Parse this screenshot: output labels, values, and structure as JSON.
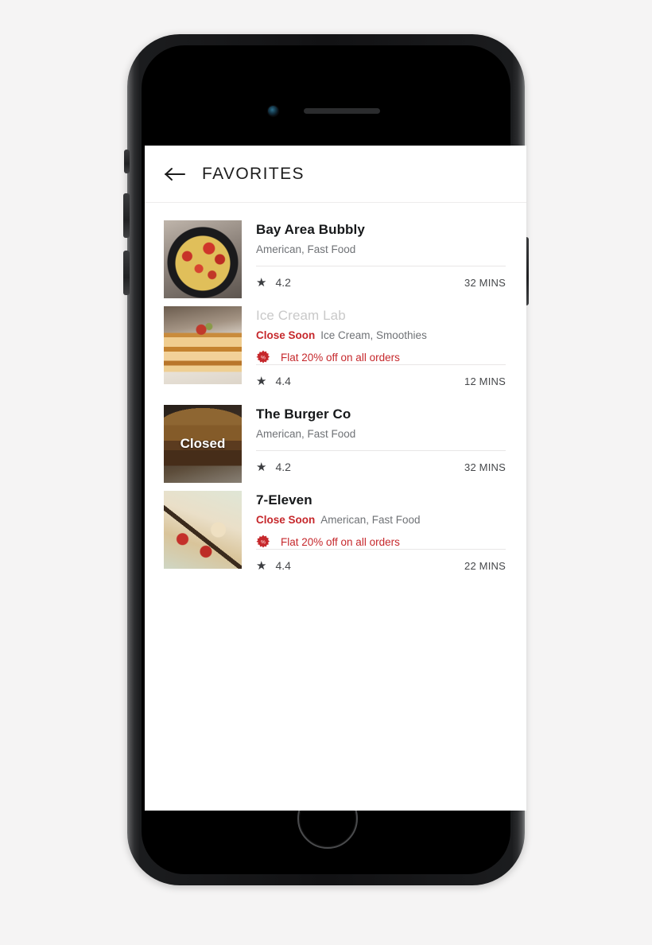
{
  "device": {
    "camera_icon": "camera-lens",
    "speaker_icon": "earpiece-speaker",
    "home_button_icon": "home-button"
  },
  "header": {
    "back_icon": "arrow-left-icon",
    "title": "FAVORITES"
  },
  "colors": {
    "accent_red": "#c6282c",
    "title_dark": "#16181a",
    "title_dimmed": "#c9c9c9",
    "meta_gray": "#6f7276",
    "page_background": "#f5f4f4",
    "screen_background": "#ffffff"
  },
  "list": {
    "star_icon": "star-icon",
    "offer_badge_icon": "discount-badge-icon",
    "items": [
      {
        "name": "Bay Area Bubbly",
        "cuisines": "American, Fast Food",
        "status": "",
        "offer": "",
        "rating": "4.2",
        "eta": "32 MINS",
        "closed_label": "",
        "dimmed": false
      },
      {
        "name": "Ice Cream Lab",
        "cuisines": "Ice Cream, Smoothies",
        "status": "Close Soon",
        "offer": "Flat 20% off on all orders",
        "rating": "4.4",
        "eta": "12 MINS",
        "closed_label": "",
        "dimmed": true
      },
      {
        "name": "The Burger Co",
        "cuisines": "American, Fast Food",
        "status": "",
        "offer": "",
        "rating": "4.2",
        "eta": "32 MINS",
        "closed_label": "Closed",
        "dimmed": false
      },
      {
        "name": "7-Eleven",
        "cuisines": "American, Fast Food",
        "status": "Close Soon",
        "offer": "Flat 20% off on all orders",
        "rating": "4.4",
        "eta": "22 MINS",
        "closed_label": "",
        "dimmed": false
      }
    ]
  }
}
